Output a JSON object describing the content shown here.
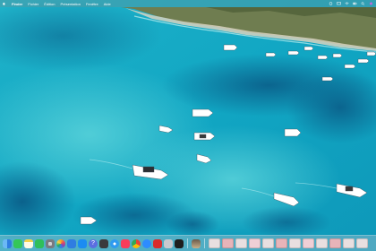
{
  "menubar": {
    "apple_icon": "apple-logo-icon",
    "app_name": "Finder",
    "items": [
      "Fichier",
      "Édition",
      "Présentation",
      "Fenêtre",
      "Aide"
    ],
    "status_icons": [
      "control-icon",
      "screen-icon",
      "wifi-icon",
      "battery-icon",
      "search-icon",
      "siri-icon"
    ]
  },
  "desktop": {
    "wallpaper": "aerial-turquoise-cove-with-boats",
    "colors": {
      "sea": "#0fa8c4",
      "deep_sea": "#0b5f86",
      "shore": "#6f7d50"
    }
  },
  "dock": {
    "apps": [
      {
        "name": "Finder",
        "icon": "finder-icon",
        "color": "#3a8ee6"
      },
      {
        "name": "Messages",
        "icon": "messages-icon",
        "color": "#34c759"
      },
      {
        "name": "Notes",
        "icon": "notes-icon",
        "color": "#f5d34a"
      },
      {
        "name": "FaceTime",
        "icon": "facetime-icon",
        "color": "#2fbf5a"
      },
      {
        "name": "Réglages Système",
        "icon": "settings-icon",
        "color": "#8e8e93"
      },
      {
        "name": "Photos",
        "icon": "photos-icon",
        "color": "#f4f4f4"
      },
      {
        "name": "Mail",
        "icon": "mail-icon",
        "color": "#2f7de1"
      },
      {
        "name": "App Store",
        "icon": "app-store-icon",
        "color": "#1b8cf2"
      },
      {
        "name": "Aide",
        "icon": "help-icon",
        "color": "#5b6ee1"
      },
      {
        "name": "Calculette",
        "icon": "calculator-icon",
        "color": "#3a3a3c"
      },
      {
        "name": "Safari",
        "icon": "safari-icon",
        "color": "#2e9bf0"
      },
      {
        "name": "Musique",
        "icon": "music-icon",
        "color": "#fa3c5a"
      },
      {
        "name": "Chrome",
        "icon": "chrome-icon",
        "color": "#f2f2f2"
      },
      {
        "name": "Zoom",
        "icon": "zoom-icon",
        "color": "#2d8cff"
      },
      {
        "name": "Acrobat",
        "icon": "acrobat-icon",
        "color": "#d92c2c"
      },
      {
        "name": "Préférences",
        "icon": "preferences-icon",
        "color": "#c9c9cf"
      },
      {
        "name": "Terminal",
        "icon": "terminal-icon",
        "color": "#1e1e1e"
      }
    ],
    "recent": [
      {
        "name": "Photo",
        "icon": "photo-thumbnail-icon",
        "color": "#6b5a4a"
      }
    ],
    "documents": [
      "document-thumbnail",
      "document-thumbnail",
      "document-thumbnail",
      "document-thumbnail",
      "document-thumbnail",
      "document-thumbnail",
      "document-thumbnail",
      "document-thumbnail",
      "document-thumbnail",
      "document-thumbnail",
      "document-thumbnail",
      "document-thumbnail"
    ]
  }
}
